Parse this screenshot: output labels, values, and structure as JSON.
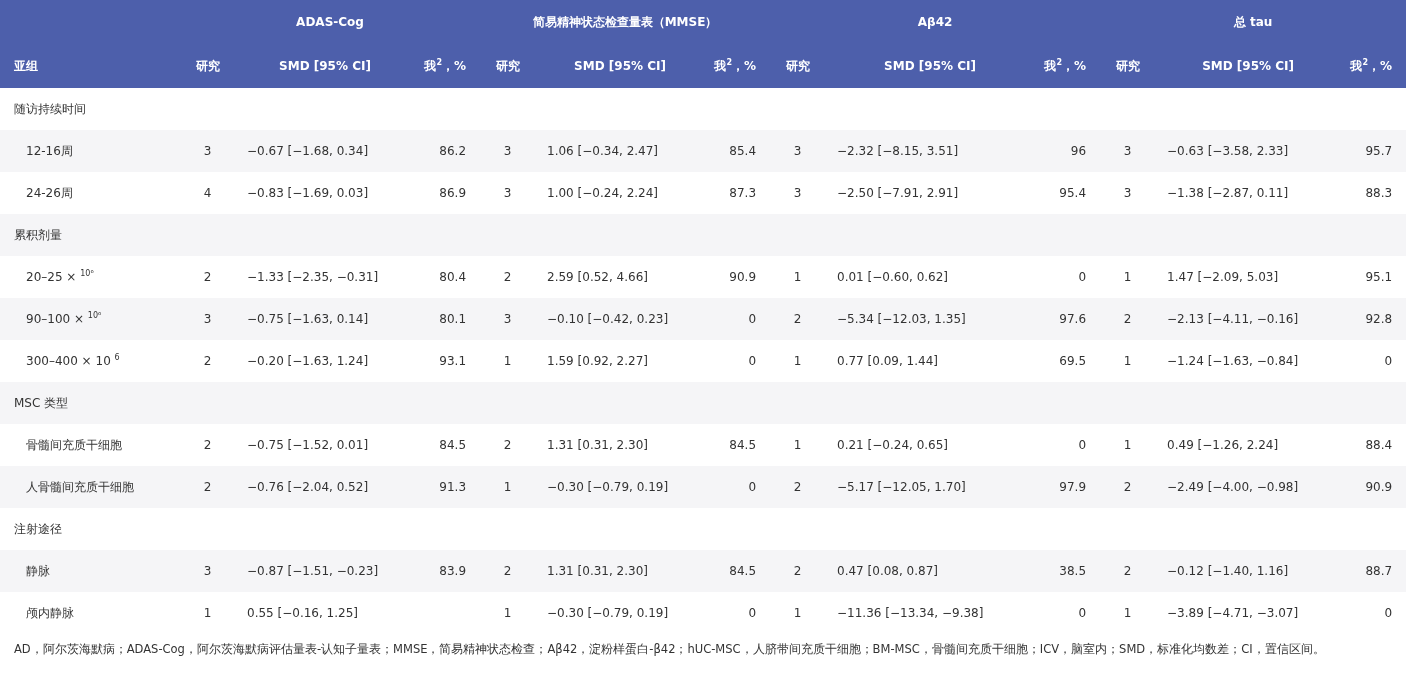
{
  "table": {
    "group_headers": [
      "ADAS-Cog",
      "简易精神状态检查量表（MMSE）",
      "Aβ42",
      "总 tau"
    ],
    "columns": {
      "subgroup": "亚组",
      "studies": [
        "研究",
        "研究",
        "研究",
        "研究"
      ],
      "smd": [
        "SMD [95% CI]",
        "SMD [95% CI]",
        "SMD [95% CI]",
        "SMD [95% CI]"
      ],
      "i2": [
        "我$^{2}$，%",
        "我$^{2}$，%",
        "我$^{2}$，%",
        "我$^{2}$，%"
      ]
    },
    "rows": [
      {
        "kind": "group",
        "label": "随访持续时间"
      },
      {
        "kind": "data",
        "label": "12-16周",
        "cells": [
          {
            "studies": "3",
            "smd": "−0.67 [−1.68, 0.34]",
            "i2": "86.2"
          },
          {
            "studies": "3",
            "smd": "1.06 [−0.34, 2.47]",
            "i2": "85.4"
          },
          {
            "studies": "3",
            "smd": "−2.32 [−8.15, 3.51]",
            "i2": "96"
          },
          {
            "studies": "3",
            "smd": "−0.63 [−3.58, 2.33]",
            "i2": "95.7"
          }
        ]
      },
      {
        "kind": "data",
        "label": "24-26周",
        "cells": [
          {
            "studies": "4",
            "smd": "−0.83 [−1.69, 0.03]",
            "i2": "86.9"
          },
          {
            "studies": "3",
            "smd": "1.00 [−0.24, 2.24]",
            "i2": "87.3"
          },
          {
            "studies": "3",
            "smd": "−2.50 [−7.91, 2.91]",
            "i2": "95.4"
          },
          {
            "studies": "3",
            "smd": "−1.38 [−2.87, 0.11]",
            "i2": "88.3"
          }
        ]
      },
      {
        "kind": "group",
        "label": "累积剂量"
      },
      {
        "kind": "data",
        "label": "20–25 × $^{10⁶}$",
        "cells": [
          {
            "studies": "2",
            "smd": "−1.33 [−2.35, −0.31]",
            "i2": "80.4"
          },
          {
            "studies": "2",
            "smd": "2.59 [0.52, 4.66]",
            "i2": "90.9"
          },
          {
            "studies": "1",
            "smd": "0.01 [−0.60, 0.62]",
            "i2": "0"
          },
          {
            "studies": "1",
            "smd": "1.47 [−2.09, 5.03]",
            "i2": "95.1"
          }
        ]
      },
      {
        "kind": "data",
        "label": "90–100 × $^{10⁶}$",
        "cells": [
          {
            "studies": "3",
            "smd": "−0.75 [−1.63, 0.14]",
            "i2": "80.1"
          },
          {
            "studies": "3",
            "smd": "−0.10 [−0.42, 0.23]",
            "i2": "0"
          },
          {
            "studies": "2",
            "smd": "−5.34 [−12.03, 1.35]",
            "i2": "97.6"
          },
          {
            "studies": "2",
            "smd": "−2.13 [−4.11, −0.16]",
            "i2": "92.8"
          }
        ]
      },
      {
        "kind": "data",
        "label": "300–400 × 10 $^{6}$",
        "cells": [
          {
            "studies": "2",
            "smd": "−0.20 [−1.63, 1.24]",
            "i2": "93.1"
          },
          {
            "studies": "1",
            "smd": "1.59 [0.92, 2.27]",
            "i2": "0"
          },
          {
            "studies": "1",
            "smd": "0.77 [0.09, 1.44]",
            "i2": "69.5"
          },
          {
            "studies": "1",
            "smd": "−1.24 [−1.63, −0.84]",
            "i2": "0"
          }
        ]
      },
      {
        "kind": "group",
        "label": "MSC 类型"
      },
      {
        "kind": "data",
        "label": "骨髓间充质干细胞",
        "cells": [
          {
            "studies": "2",
            "smd": "−0.75 [−1.52, 0.01]",
            "i2": "84.5"
          },
          {
            "studies": "2",
            "smd": "1.31 [0.31, 2.30]",
            "i2": "84.5"
          },
          {
            "studies": "1",
            "smd": "0.21 [−0.24, 0.65]",
            "i2": "0"
          },
          {
            "studies": "1",
            "smd": "0.49 [−1.26, 2.24]",
            "i2": "88.4"
          }
        ]
      },
      {
        "kind": "data",
        "label": "人骨髓间充质干细胞",
        "cells": [
          {
            "studies": "2",
            "smd": "−0.76 [−2.04, 0.52]",
            "i2": "91.3"
          },
          {
            "studies": "1",
            "smd": "−0.30 [−0.79, 0.19]",
            "i2": "0"
          },
          {
            "studies": "2",
            "smd": "−5.17 [−12.05, 1.70]",
            "i2": "97.9"
          },
          {
            "studies": "2",
            "smd": "−2.49 [−4.00, −0.98]",
            "i2": "90.9"
          }
        ]
      },
      {
        "kind": "group",
        "label": "注射途径"
      },
      {
        "kind": "data",
        "label": "静脉",
        "cells": [
          {
            "studies": "3",
            "smd": "−0.87 [−1.51, −0.23]",
            "i2": "83.9"
          },
          {
            "studies": "2",
            "smd": "1.31 [0.31, 2.30]",
            "i2": "84.5"
          },
          {
            "studies": "2",
            "smd": "0.47 [0.08, 0.87]",
            "i2": "38.5"
          },
          {
            "studies": "2",
            "smd": "−0.12 [−1.40, 1.16]",
            "i2": "88.7"
          }
        ]
      },
      {
        "kind": "data",
        "label": "颅内静脉",
        "cells": [
          {
            "studies": "1",
            "smd": "0.55 [−0.16, 1.25]"
          },
          {
            "studies": "1",
            "smd": "−0.30 [−0.79, 0.19]",
            "i2": "0"
          },
          {
            "studies": "1",
            "smd": "−11.36 [−13.34, −9.38]",
            "i2": "0"
          },
          {
            "studies": "1",
            "smd": "−3.89 [−4.71, −3.07]",
            "i2": "0"
          }
        ]
      }
    ]
  },
  "footnote": "AD，阿尔茨海默病；ADAS-Cog，阿尔茨海默病评估量表-认知子量表；MMSE，简易精神状态检查；Aβ42，淀粉样蛋白-β42；hUC-MSC，人脐带间充质干细胞；BM-MSC，骨髓间充质干细胞；ICV，脑室内；SMD，标准化均数差；CI，置信区间。"
}
